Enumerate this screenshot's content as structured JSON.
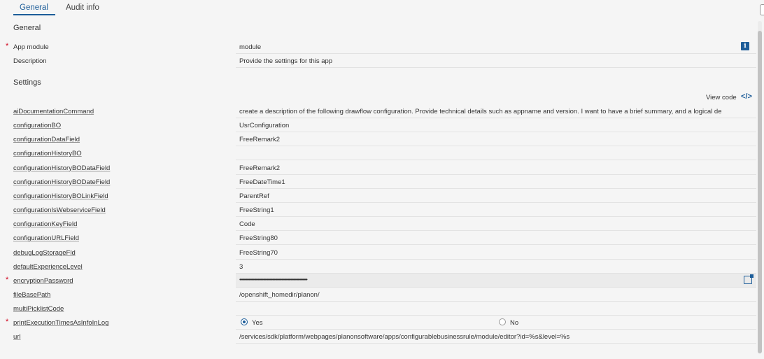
{
  "tabs": [
    {
      "label": "General",
      "active": true
    },
    {
      "label": "Audit info",
      "active": false
    }
  ],
  "general": {
    "title": "General",
    "fields": [
      {
        "label": "App module",
        "required": true,
        "value": "module"
      },
      {
        "label": "Description",
        "required": false,
        "value": "Provide the settings for this app"
      }
    ]
  },
  "settings": {
    "title": "Settings",
    "view_code_label": "View code",
    "view_code_icon": "code-icon",
    "fields": [
      {
        "label": "aiDocumentationCommand",
        "required": false,
        "value": "create a description of the following drawflow configuration. Provide technical details such as appname and version. I want to have a brief summary, and a logical de"
      },
      {
        "label": "configurationBO",
        "required": false,
        "value": "UsrConfiguration"
      },
      {
        "label": "configurationDataField",
        "required": false,
        "value": "FreeRemark2"
      },
      {
        "label": "configurationHistoryBO",
        "required": false,
        "value": ""
      },
      {
        "label": "configurationHistoryBODataField",
        "required": false,
        "value": "FreeRemark2"
      },
      {
        "label": "configurationHistoryBODateField",
        "required": false,
        "value": "FreeDateTime1"
      },
      {
        "label": "configurationHistoryBOLinkField",
        "required": false,
        "value": "ParentRef"
      },
      {
        "label": "configurationIsWebserviceField",
        "required": false,
        "value": "FreeString1"
      },
      {
        "label": "configurationKeyField",
        "required": false,
        "value": "Code"
      },
      {
        "label": "configurationURLField",
        "required": false,
        "value": "FreeString80"
      },
      {
        "label": "debugLogStorageFld",
        "required": false,
        "value": "FreeString70"
      },
      {
        "label": "defaultExperienceLevel",
        "required": false,
        "value": "3"
      },
      {
        "label": "encryptionPassword",
        "required": true,
        "value": "••••••••••••••••••••••••••••••••••••••••••••••••••••••••••••••••••••••••••"
      },
      {
        "label": "fileBasePath",
        "required": false,
        "value": "/openshift_homedir/planon/"
      },
      {
        "label": "multiPicklistCode",
        "required": false,
        "value": ""
      },
      {
        "label": "printExecutionTimesAsInfoInLog",
        "required": true,
        "value": "",
        "options": [
          {
            "label": "Yes",
            "selected": true
          },
          {
            "label": "No",
            "selected": false
          }
        ]
      },
      {
        "label": "url",
        "required": false,
        "value": "/services/sdk/platform/webpages/planonsoftware/apps/configurablebusinessrule/module/editor?id=%s&level=%s"
      }
    ]
  },
  "icons": {
    "info": "info-icon",
    "reveal_password": "external-window-icon"
  },
  "colors": {
    "accent": "#1d5d99",
    "required": "#d0021b"
  }
}
